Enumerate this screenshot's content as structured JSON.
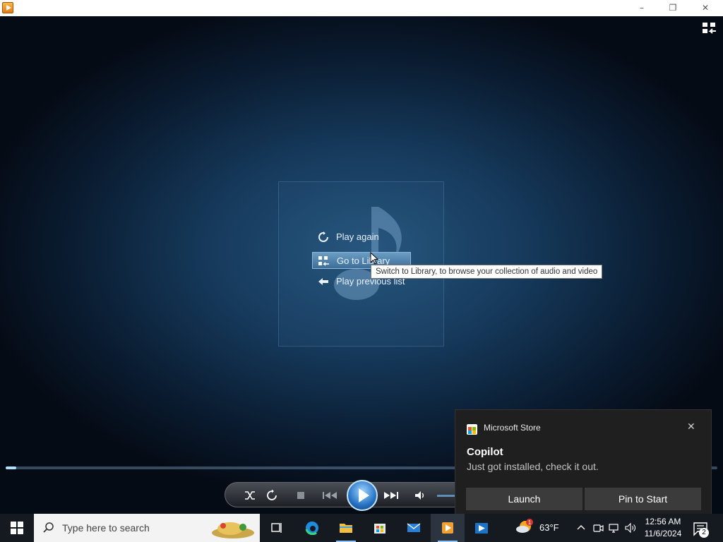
{
  "window": {
    "icon": "media-player-icon",
    "controls": {
      "minimize": "–",
      "restore": "❐",
      "close": "✕"
    }
  },
  "player": {
    "switch_icon": "switch-view-icon",
    "menu": {
      "play_again": "Play again",
      "go_to_library": "Go to Library",
      "play_previous_list": "Play previous list"
    },
    "tooltip": "Switch to Library, to browse your collection of audio and video",
    "seek_progress_fraction": 0.015
  },
  "toast": {
    "app_name": "Microsoft Store",
    "title": "Copilot",
    "body": "Just got installed, check it out.",
    "close": "✕",
    "buttons": {
      "launch": "Launch",
      "pin": "Pin to Start"
    }
  },
  "taskbar": {
    "search_placeholder": "Type here to search",
    "weather": {
      "temp": "63°F",
      "badge": "1"
    },
    "clock": {
      "time": "12:56 AM",
      "date": "11/6/2024"
    },
    "notifications": "2",
    "colors": {
      "accent": "#8ec5ff",
      "taskbar": "#151a21"
    }
  }
}
